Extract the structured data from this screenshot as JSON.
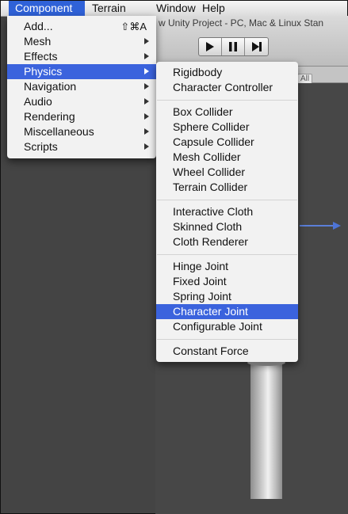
{
  "menubar": {
    "items": [
      "Component",
      "Terrain",
      "Window",
      "Help"
    ]
  },
  "window": {
    "title": "w Unity Project - PC, Mac & Linux Stan",
    "scene_filter": "All"
  },
  "component_menu": {
    "items": [
      {
        "label": "Add...",
        "shortcut": "⇧⌘A"
      },
      {
        "label": "Mesh"
      },
      {
        "label": "Effects"
      },
      {
        "label": "Physics"
      },
      {
        "label": "Navigation"
      },
      {
        "label": "Audio"
      },
      {
        "label": "Rendering"
      },
      {
        "label": "Miscellaneous"
      },
      {
        "label": "Scripts"
      }
    ]
  },
  "physics_menu": {
    "items": [
      "Rigidbody",
      "Character Controller",
      "Box Collider",
      "Sphere Collider",
      "Capsule Collider",
      "Mesh Collider",
      "Wheel Collider",
      "Terrain Collider",
      "Interactive Cloth",
      "Skinned Cloth",
      "Cloth Renderer",
      "Hinge Joint",
      "Fixed Joint",
      "Spring Joint",
      "Character Joint",
      "Configurable Joint",
      "Constant Force"
    ],
    "highlighted": "Character Joint"
  },
  "colors": {
    "selection": "#3b63dd",
    "menu_bg": "#f2f2f2",
    "scene_bg": "#444444"
  },
  "icons": {
    "play": "play-icon",
    "pause": "pause-icon",
    "step": "step-icon",
    "submenu": "chevron-right-icon"
  }
}
